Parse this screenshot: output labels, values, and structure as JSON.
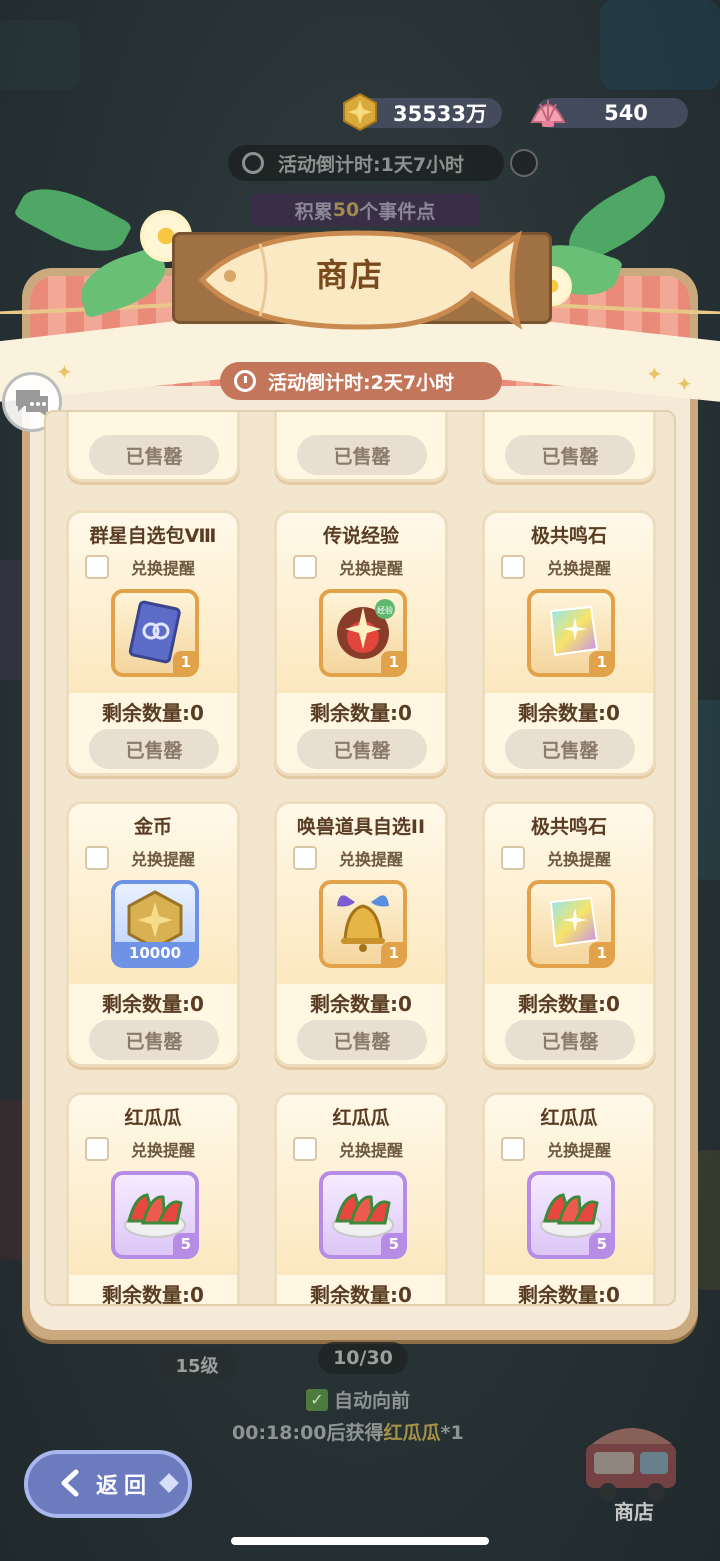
{
  "currency": {
    "gold": "35533万",
    "shells": "540"
  },
  "background": {
    "countdown": "活动倒计时:1天7小时",
    "events_prefix": "积累",
    "events_count": "50",
    "events_suffix": "个事件点",
    "level": "15级",
    "progress": "10/30",
    "auto_forward": "自动向前",
    "reward_prefix": "00:18:00后获得",
    "reward_item": "红瓜瓜",
    "reward_suffix": "*1"
  },
  "shop": {
    "title": "商店",
    "countdown": "活动倒计时:2天7小时",
    "remind_label": "兑换提醒",
    "sold_out": "已售罄",
    "items": [
      {
        "name": "群星自选包Ⅷ",
        "qty": "1",
        "remaining": "剩余数量:0",
        "icon": "card-pack-icon",
        "frame": "orange"
      },
      {
        "name": "传说经验",
        "qty": "1",
        "remaining": "剩余数量:0",
        "icon": "legend-exp-icon",
        "frame": "orange",
        "badge": "经验"
      },
      {
        "name": "极共鸣石",
        "qty": "1",
        "remaining": "剩余数量:0",
        "icon": "crystal-icon",
        "frame": "orange"
      },
      {
        "name": "金币",
        "qty": "10000",
        "remaining": "剩余数量:0",
        "icon": "gold-coin-icon",
        "frame": "blue"
      },
      {
        "name": "唤兽道具自选II",
        "qty": "1",
        "remaining": "剩余数量:0",
        "icon": "bell-icon",
        "frame": "orange"
      },
      {
        "name": "极共鸣石",
        "qty": "1",
        "remaining": "剩余数量:0",
        "icon": "crystal-icon",
        "frame": "orange"
      },
      {
        "name": "红瓜瓜",
        "qty": "5",
        "remaining": "剩余数量:0",
        "icon": "watermelon-icon",
        "frame": "purple"
      },
      {
        "name": "红瓜瓜",
        "qty": "5",
        "remaining": "剩余数量:0",
        "icon": "watermelon-icon",
        "frame": "purple"
      },
      {
        "name": "红瓜瓜",
        "qty": "5",
        "remaining": "剩余数量:0",
        "icon": "watermelon-icon",
        "frame": "purple"
      }
    ]
  },
  "nav": {
    "back_label": "返回",
    "shop_label": "商店"
  },
  "colors": {
    "panel": "#c9a97d",
    "stripe": "#e98b78",
    "timer": "#c4765a",
    "back": "#6b7bbd"
  }
}
